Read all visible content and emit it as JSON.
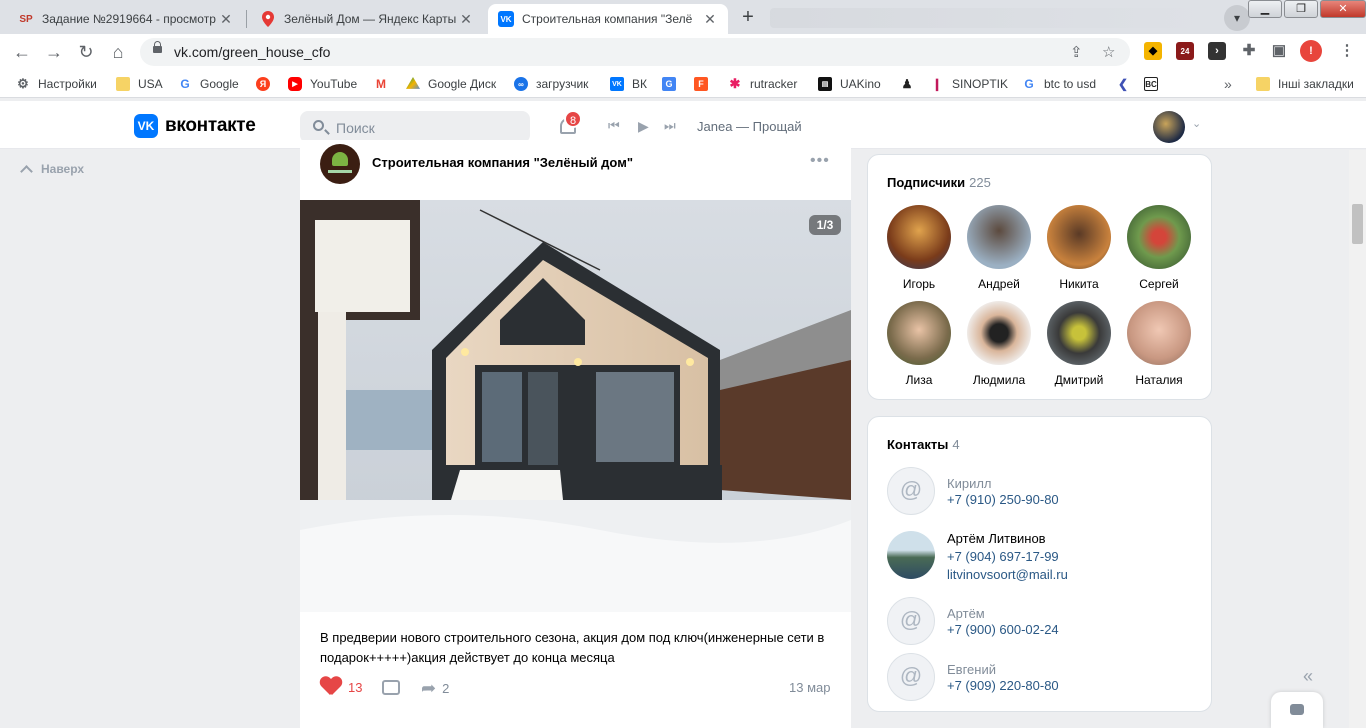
{
  "browser": {
    "tabs": [
      {
        "title": "Задание №2919664 - просмотр",
        "favicon": "SP"
      },
      {
        "title": "Зелёный Дом — Яндекс Карты",
        "favicon": "map-pin"
      },
      {
        "title": "Строительная компания \"Зелё",
        "favicon": "VK"
      }
    ],
    "url": "vk.com/green_house_cfo",
    "ext_badge": "24"
  },
  "bookmarks": [
    {
      "label": "Настройки"
    },
    {
      "label": "USA"
    },
    {
      "label": "Google"
    },
    {
      "label": "YouTube"
    },
    {
      "label": "Google Диск"
    },
    {
      "label": "загрузчик"
    },
    {
      "label": "ВК"
    },
    {
      "label": "rutracker"
    },
    {
      "label": "UAKino"
    },
    {
      "label": "SINOPTIK"
    },
    {
      "label": "btc to usd"
    },
    {
      "label": "Інші закладки"
    }
  ],
  "vk": {
    "logo_text": "вконтакте",
    "logo_mark": "VK",
    "search_placeholder": "Поиск",
    "notifications": "8",
    "track": "Janea — Прощай"
  },
  "left": {
    "to_top": "Наверх"
  },
  "post": {
    "author": "Строительная компания \"Зелёный дом\"",
    "photo_counter": "1/3",
    "text": "В предверии нового строительного сезона, акция дом под ключ(инженерные сети в подарок+++++)акция действует до конца месяца",
    "likes": "13",
    "shares": "2",
    "date": "13 мар"
  },
  "followers": {
    "title": "Подписчики",
    "count": "225",
    "items": [
      {
        "name": "Игорь"
      },
      {
        "name": "Андрей"
      },
      {
        "name": "Никита"
      },
      {
        "name": "Сергей"
      },
      {
        "name": "Лиза"
      },
      {
        "name": "Людмила"
      },
      {
        "name": "Дмитрий"
      },
      {
        "name": "Наталия"
      }
    ]
  },
  "contacts": {
    "title": "Контакты",
    "count": "4",
    "items": [
      {
        "name": "Кирилл",
        "phone": "+7 (910) 250-90-80"
      },
      {
        "name": "Артём Литвинов",
        "phone": "+7 (904) 697-17-99",
        "email": "litvinovsoort@mail.ru"
      },
      {
        "name": "Артём",
        "phone": "+7 (900) 600-02-24"
      },
      {
        "name": "Евгений",
        "phone": "+7 (909) 220-80-80"
      }
    ]
  },
  "colors": {
    "accent": "#0077ff",
    "link": "#2a5885",
    "like": "#e64646"
  }
}
